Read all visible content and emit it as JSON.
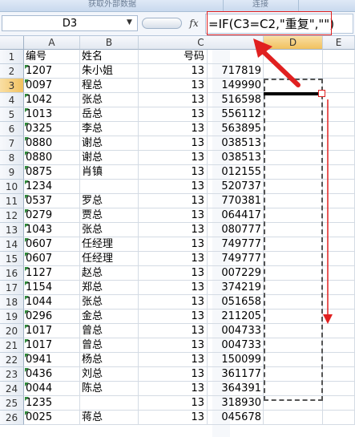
{
  "ribbon": {
    "tab_left": "获取外部数据",
    "tab_right": "连接"
  },
  "formula_bar": {
    "name_box": "D3",
    "fx_icon": "fx-icon",
    "formula": "=IF(C3=C2,\"重复\",\"\")"
  },
  "columns": [
    "A",
    "B",
    "C",
    "D",
    "E"
  ],
  "active_column": "D",
  "active_row": "3",
  "rows": [
    {
      "n": "1",
      "a": "编号",
      "b": "姓名",
      "c": "号码",
      "cx": "",
      "tri": false
    },
    {
      "n": "2",
      "a": "1207",
      "b": "朱小姐",
      "c": "13",
      "cx": "717819",
      "tri": true
    },
    {
      "n": "3",
      "a": "0097",
      "b": "程总",
      "c": "13",
      "cx": "149990",
      "tri": true
    },
    {
      "n": "4",
      "a": "1042",
      "b": "张总",
      "c": "13",
      "cx": "516598",
      "tri": true
    },
    {
      "n": "5",
      "a": "1013",
      "b": "岳总",
      "c": "13",
      "cx": "556112",
      "tri": true
    },
    {
      "n": "6",
      "a": "0325",
      "b": "李总",
      "c": "13",
      "cx": "563895",
      "tri": true
    },
    {
      "n": "7",
      "a": "0880",
      "b": "谢总",
      "c": "13",
      "cx": "038513",
      "tri": true
    },
    {
      "n": "8",
      "a": "0880",
      "b": "谢总",
      "c": "13",
      "cx": "038513",
      "tri": true
    },
    {
      "n": "9",
      "a": "0875",
      "b": "肖镇",
      "c": "13",
      "cx": "012155",
      "tri": true
    },
    {
      "n": "10",
      "a": "1234",
      "b": "",
      "c": "13",
      "cx": "520737",
      "tri": true
    },
    {
      "n": "11",
      "a": "0537",
      "b": "罗总",
      "c": "13",
      "cx": "770381",
      "tri": true
    },
    {
      "n": "12",
      "a": "0279",
      "b": "贾总",
      "c": "13",
      "cx": "064417",
      "tri": true
    },
    {
      "n": "13",
      "a": "1043",
      "b": "张总",
      "c": "13",
      "cx": "080777",
      "tri": true
    },
    {
      "n": "14",
      "a": "0607",
      "b": "任经理",
      "c": "13",
      "cx": "749777",
      "tri": true
    },
    {
      "n": "15",
      "a": "0607",
      "b": "任经理",
      "c": "13",
      "cx": "749777",
      "tri": true
    },
    {
      "n": "16",
      "a": "1127",
      "b": "赵总",
      "c": "13",
      "cx": "007229",
      "tri": true
    },
    {
      "n": "17",
      "a": "1154",
      "b": "郑总",
      "c": "13",
      "cx": "374219",
      "tri": true
    },
    {
      "n": "18",
      "a": "1044",
      "b": "张总",
      "c": "13",
      "cx": "051658",
      "tri": true
    },
    {
      "n": "19",
      "a": "0296",
      "b": "金总",
      "c": "13",
      "cx": "211205",
      "tri": true
    },
    {
      "n": "20",
      "a": "1017",
      "b": "曾总",
      "c": "13",
      "cx": "004733",
      "tri": true
    },
    {
      "n": "21",
      "a": "1017",
      "b": "曾总",
      "c": "13",
      "cx": "004733",
      "tri": true
    },
    {
      "n": "22",
      "a": "0941",
      "b": "杨总",
      "c": "13",
      "cx": "150099",
      "tri": true
    },
    {
      "n": "23",
      "a": "0436",
      "b": "刘总",
      "c": "13",
      "cx": "361177",
      "tri": true
    },
    {
      "n": "24",
      "a": "0044",
      "b": "陈总",
      "c": "13",
      "cx": "364391",
      "tri": true
    },
    {
      "n": "25",
      "a": "1235",
      "b": "",
      "c": "13",
      "cx": "318930",
      "tri": true
    },
    {
      "n": "26",
      "a": "0025",
      "b": "蒋总",
      "c": "13",
      "cx": "045678",
      "tri": true
    }
  ],
  "annotation_colors": {
    "arrow": "#e02020",
    "highlight_box": "#e02020"
  }
}
